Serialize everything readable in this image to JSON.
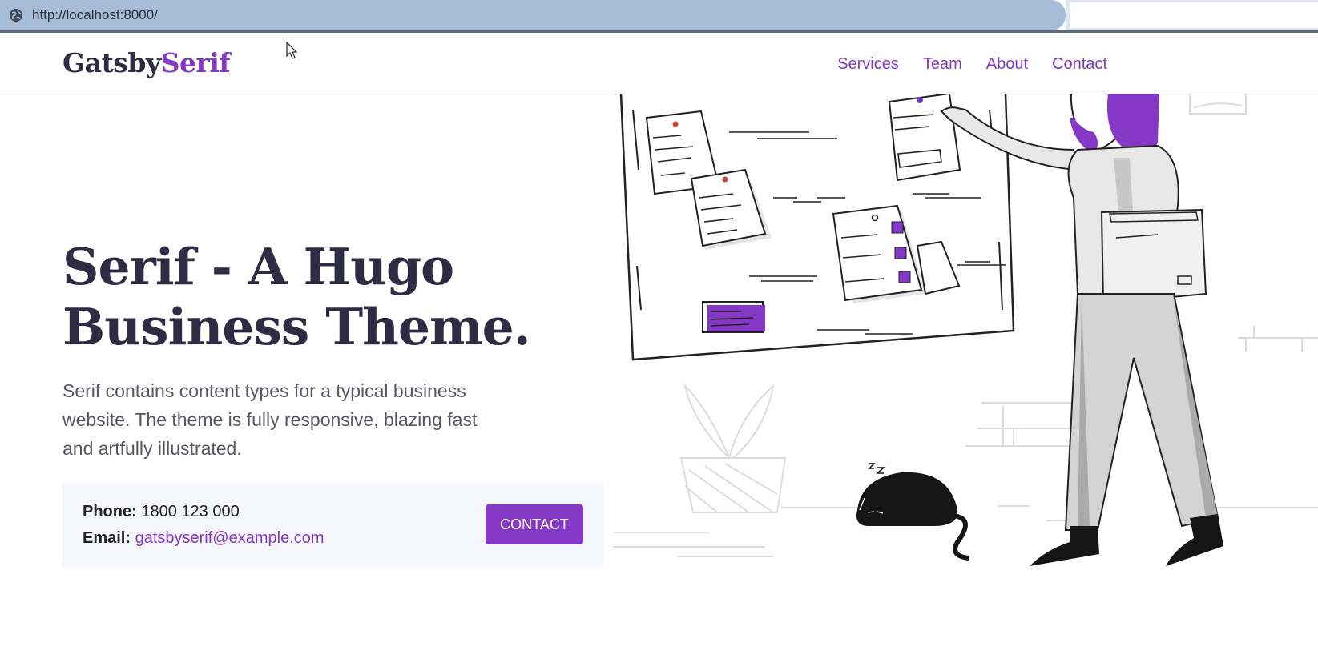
{
  "browser": {
    "url": "http://localhost:8000/"
  },
  "header": {
    "logo_part1": "Gatsby",
    "logo_part2": "Serif",
    "nav": [
      {
        "label": "Services"
      },
      {
        "label": "Team"
      },
      {
        "label": "About"
      },
      {
        "label": "Contact"
      }
    ]
  },
  "hero": {
    "title": "Serif - A Hugo Business Theme.",
    "description": "Serif contains content types for a typical business website. The theme is fully responsive, blazing fast and artfully illustrated."
  },
  "call": {
    "phone_label": "Phone:",
    "phone_value": "1800 123 000",
    "email_label": "Email:",
    "email_value": "gatsbyserif@example.com",
    "button_label": "CONTACT"
  },
  "colors": {
    "accent": "#8537c6",
    "heading": "#2e2c43",
    "call_box_bg": "#f6f6fd"
  },
  "icons": {
    "address_bar": "globe-icon",
    "pointer": "mouse-cursor-icon"
  }
}
